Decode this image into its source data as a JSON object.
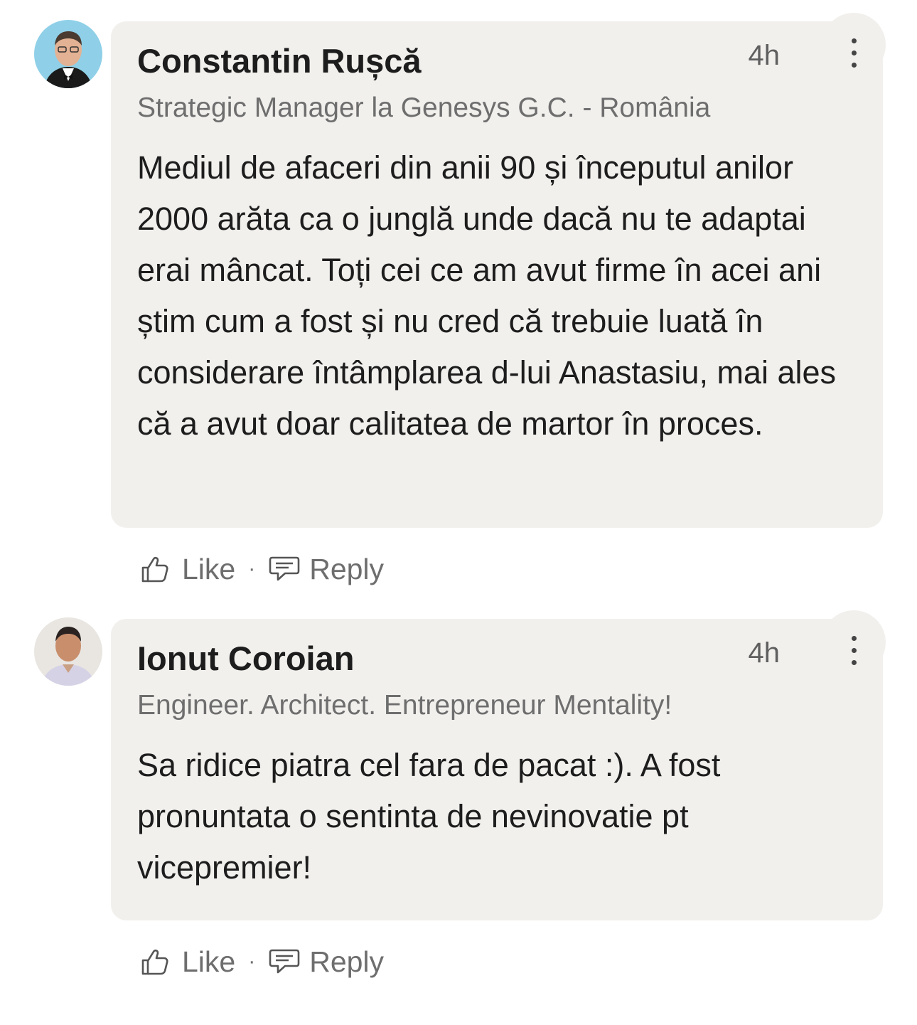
{
  "comments": [
    {
      "author": "Constantin Rușcă",
      "time": "4h",
      "headline": "Strategic Manager la Genesys G.C. - România",
      "text": "Mediul de afaceri din anii 90 și începutul anilor 2000 arăta ca o junglă unde dacă nu te adaptai erai mâncat. Toți cei ce am avut firme în acei ani știm cum a fost și nu cred că trebuie luată în considerare întâmplarea d-lui Anastasiu, mai ales că a avut doar calitatea de martor în proces.",
      "like_label": "Like",
      "separator": "·",
      "reply_label": "Reply"
    },
    {
      "author": "Ionut Coroian",
      "time": "4h",
      "headline": "Engineer. Architect. Entrepreneur Mentality!",
      "text": "Sa ridice piatra cel fara de pacat :). A fost pronuntata o sentinta de nevinovatie pt vicepremier!",
      "like_label": "Like",
      "separator": "·",
      "reply_label": "Reply"
    }
  ],
  "icons": {
    "like": "thumbs-up-icon",
    "reply": "speech-bubble-icon",
    "more": "more-vertical-icon"
  },
  "colors": {
    "bubble_bg": "#f2f0ed",
    "secondary_text": "#6e6e6e",
    "primary_text": "#1d1d1d"
  }
}
